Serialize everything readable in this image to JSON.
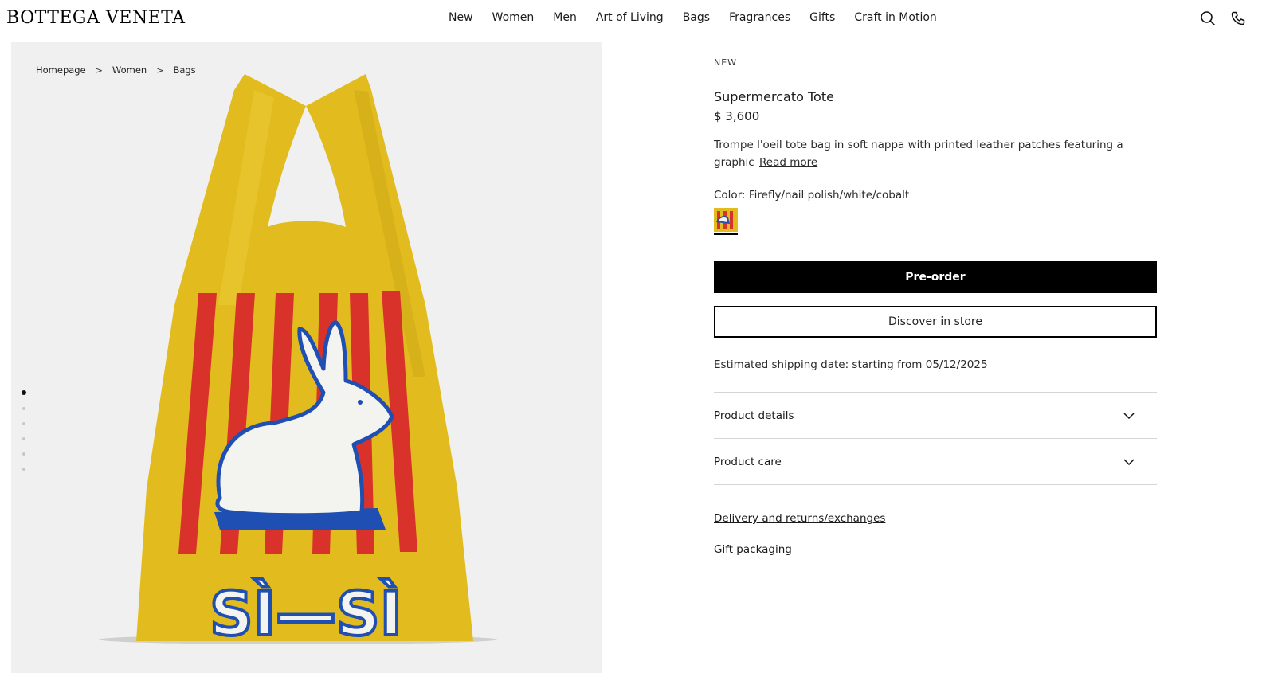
{
  "brand": {
    "logo": "BOTTEGA VENETA"
  },
  "nav": [
    "New",
    "Women",
    "Men",
    "Art of Living",
    "Bags",
    "Fragrances",
    "Gifts",
    "Craft in Motion"
  ],
  "header_icons": [
    "search-icon",
    "phone-icon"
  ],
  "breadcrumb": [
    "Homepage",
    "Women",
    "Bags"
  ],
  "gallery": {
    "total_images": 6,
    "active_index": 0,
    "bag_text": "SÌ—SÌ"
  },
  "product": {
    "badge": "NEW",
    "title": "Supermercato Tote",
    "price": "$ 3,600",
    "description": "Trompe l'oeil tote bag in soft nappa with printed leather patches featuring a graphic",
    "read_more": "Read more",
    "color_label": "Color: Firefly/nail polish/white/cobalt",
    "preorder_label": "Pre-order",
    "discover_label": "Discover in store",
    "shipping": "Estimated shipping date: starting from 05/12/2025",
    "accordions": [
      "Product details",
      "Product care"
    ],
    "links": [
      "Delivery and returns/exchanges",
      "Gift packaging"
    ]
  },
  "colors": {
    "bag_yellow": "#e3bd1f",
    "stripe_red": "#d8322a",
    "rabbit_blue": "#1f4fb3",
    "button_black": "#000000"
  }
}
